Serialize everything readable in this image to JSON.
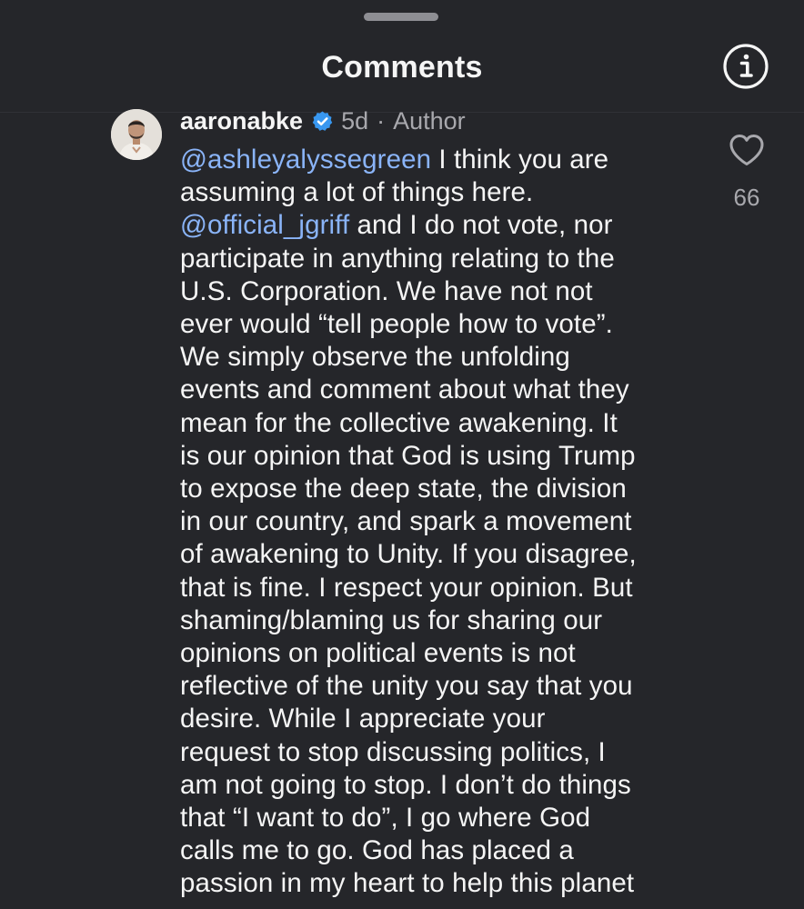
{
  "header": {
    "title": "Comments",
    "info_icon": "info-circle-icon"
  },
  "comment": {
    "username": "aaronabke",
    "verified_icon": "verified-badge-icon",
    "time": "5d",
    "separator": "·",
    "role": "Author",
    "mention_1": "@ashleyalyssegreen",
    "text_1": " I think you are\nassuming a lot of things here.\n",
    "mention_2": "@official_jgriff",
    "text_2": " and I do not vote, nor\nparticipate in anything relating to the\nU.S. Corporation. We have not not\never would “tell people how to vote”.\nWe simply observe the unfolding\nevents and comment about what they\nmean for the collective awakening. It\nis our opinion that God is using Trump\nto expose the deep state, the division\nin our country, and spark a movement\nof awakening to Unity. If you disagree,\nthat is fine. I respect your opinion. But\nshaming/blaming us for sharing our\nopinions on political events is not\nreflective of the unity you say that you\ndesire. While I appreciate your\nrequest to stop discussing politics, I\nam not going to stop. I don’t do things\nthat “I want to do”, I go where God\ncalls me to go. God has placed a\npassion in my heart to help this planet",
    "like_icon": "heart-outline-icon",
    "like_count": "66"
  },
  "colors": {
    "background": "#25262a",
    "text": "#f5f5f5",
    "secondary_text": "#a8a8ad",
    "mention": "#8ab4f8",
    "verified": "#3897f0"
  }
}
